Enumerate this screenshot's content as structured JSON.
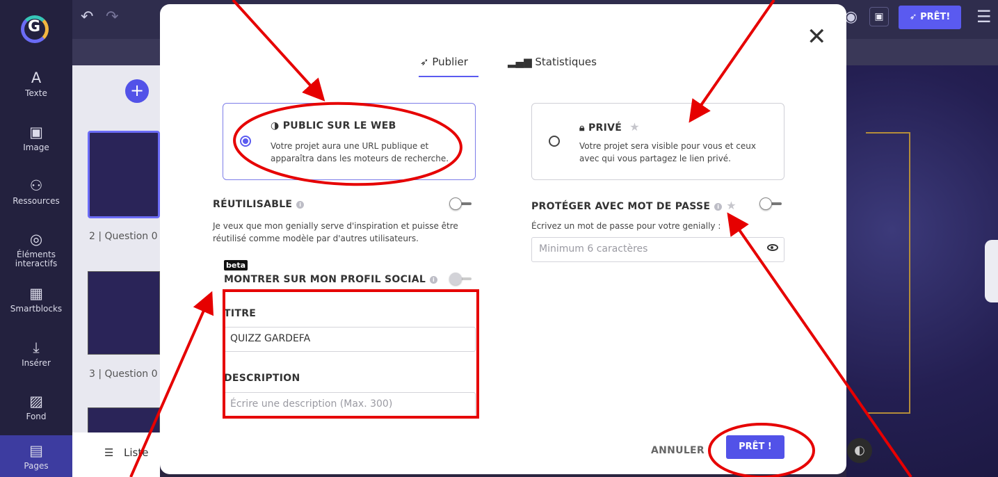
{
  "sidebar": {
    "items": [
      {
        "label": "Texte",
        "icon": "A"
      },
      {
        "label": "Image",
        "icon": "▣"
      },
      {
        "label": "Ressources",
        "icon": "⚇"
      },
      {
        "label": "Éléments interactifs",
        "icon": "◎"
      },
      {
        "label": "Smartblocks",
        "icon": "▦"
      },
      {
        "label": "Insérer",
        "icon": "⤓"
      },
      {
        "label": "Fond",
        "icon": "▨"
      },
      {
        "label": "Pages",
        "icon": "▤"
      }
    ]
  },
  "topbar": {
    "ready_label": "PRÊT!",
    "menu_icon": "☰"
  },
  "pages_panel": {
    "thumbs": [
      {
        "label": "2 |  Question 0"
      },
      {
        "label": "3 |  Question 0"
      }
    ],
    "list_label": "Liste"
  },
  "modal": {
    "tabs": [
      {
        "label": "Publier",
        "icon": "rocket-icon"
      },
      {
        "label": "Statistiques",
        "icon": "bar-chart-icon"
      }
    ],
    "public_card": {
      "title": "PUBLIC SUR LE WEB",
      "description": "Votre projet aura une URL publique et apparaîtra dans les moteurs de recherche."
    },
    "private_card": {
      "title": "PRIVÉ",
      "description": "Votre projet sera visible pour vous et ceux avec qui vous partagez le lien privé."
    },
    "reusable": {
      "title": "RÉUTILISABLE",
      "description": "Je veux que mon genially serve d'inspiration et puisse être réutilisé comme modèle par d'autres utilisateurs."
    },
    "password": {
      "title": "PROTÉGER AVEC MOT DE PASSE",
      "description": "Écrivez un mot de passe pour votre genially :",
      "placeholder": "Minimum 6 caractères"
    },
    "social": {
      "badge": "beta",
      "title": "MONTRER SUR MON PROFIL SOCIAL",
      "title_label": "TITRE",
      "title_value": "QUIZZ GARDEFA",
      "description_label": "DESCRIPTION",
      "description_placeholder": "Écrire une description (Max. 300)"
    },
    "cancel_label": "ANNULER",
    "ready_label": "PRÊT !"
  },
  "colors": {
    "accent": "#5a5af0",
    "annotation": "#e60000",
    "sidebar_bg": "#23213e"
  }
}
